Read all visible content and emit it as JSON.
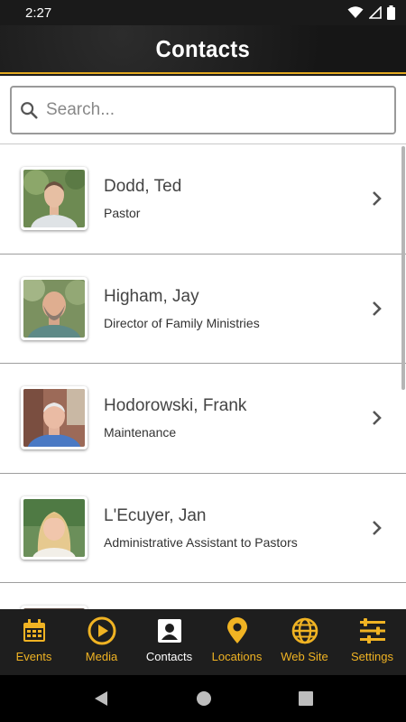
{
  "status": {
    "time": "2:27"
  },
  "header": {
    "title": "Contacts"
  },
  "search": {
    "placeholder": "Search..."
  },
  "contacts": [
    {
      "name": "Dodd, Ted",
      "title": "Pastor"
    },
    {
      "name": "Higham, Jay",
      "title": "Director of Family Ministries"
    },
    {
      "name": "Hodorowski, Frank",
      "title": "Maintenance"
    },
    {
      "name": "L'Ecuyer, Jan",
      "title": "Administrative Assistant to Pastors"
    }
  ],
  "tabs": [
    {
      "label": "Events",
      "icon": "calendar-icon"
    },
    {
      "label": "Media",
      "icon": "play-icon"
    },
    {
      "label": "Contacts",
      "icon": "contact-card-icon"
    },
    {
      "label": "Locations",
      "icon": "map-pin-icon"
    },
    {
      "label": "Web Site",
      "icon": "globe-icon"
    },
    {
      "label": "Settings",
      "icon": "sliders-icon"
    }
  ],
  "colors": {
    "accent": "#f0b323",
    "header_border": "#e3a921",
    "active_tab": "#ffffff"
  }
}
